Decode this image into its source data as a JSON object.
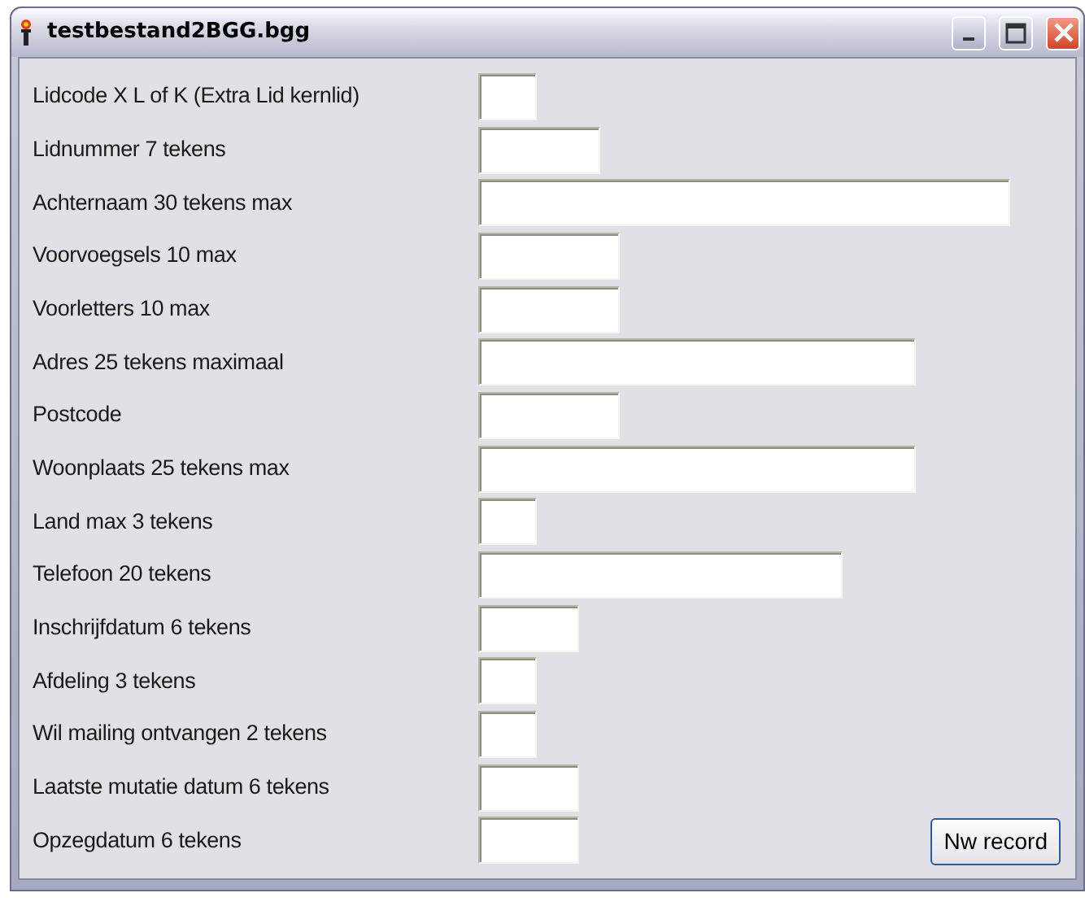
{
  "window": {
    "title": "testbestand2BGG.bgg"
  },
  "fields": [
    {
      "label": "Lidcode X L of K (Extra Lid kernlid)"
    },
    {
      "label": "Lidnummer 7 tekens"
    },
    {
      "label": "Achternaam 30 tekens max"
    },
    {
      "label": "Voorvoegsels 10 max"
    },
    {
      "label": "Voorletters 10 max"
    },
    {
      "label": "Adres 25 tekens maximaal"
    },
    {
      "label": "Postcode"
    },
    {
      "label": "Woonplaats 25 tekens max"
    },
    {
      "label": "Land max 3 tekens"
    },
    {
      "label": "Telefoon 20 tekens"
    },
    {
      "label": "Inschrijfdatum 6 tekens"
    },
    {
      "label": "Afdeling 3 tekens"
    },
    {
      "label": "Wil mailing ontvangen 2 tekens"
    },
    {
      "label": "Laatste mutatie datum 6 tekens"
    },
    {
      "label": "Opzegdatum 6 tekens"
    }
  ],
  "buttons": [
    {
      "label": "Nw record"
    }
  ]
}
